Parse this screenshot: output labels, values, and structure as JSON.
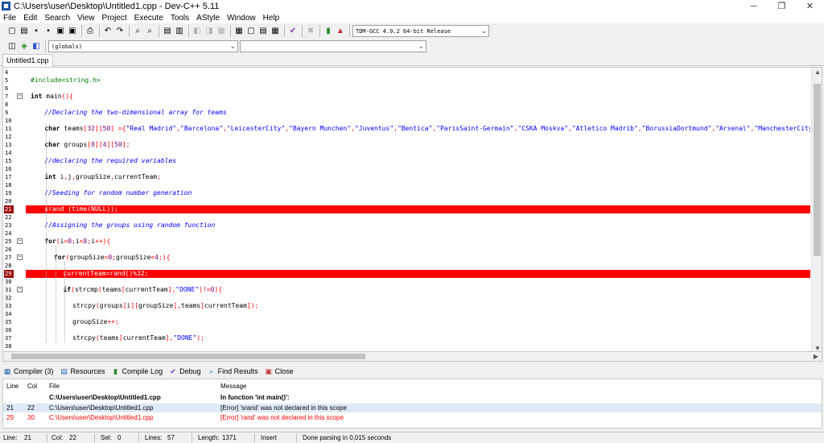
{
  "window": {
    "title": "C:\\Users\\user\\Desktop\\Untitled1.cpp - Dev-C++ 5.11",
    "minimize_glyph": "─",
    "maximize_glyph": "❐",
    "close_glyph": "✕"
  },
  "menu": [
    "File",
    "Edit",
    "Search",
    "View",
    "Project",
    "Execute",
    "Tools",
    "AStyle",
    "Window",
    "Help"
  ],
  "toolbar": {
    "compiler_select": "TDM-GCC 4.9.2 64-bit Release",
    "scope_select": "(globals)",
    "symbol_select": ""
  },
  "file_tab": "Untitled1.cpp",
  "editor": {
    "lines": [
      {
        "n": "4",
        "parts": []
      },
      {
        "n": "5",
        "parts": [
          {
            "t": "#include<string.h>",
            "c": "pre"
          }
        ]
      },
      {
        "n": "6",
        "parts": []
      },
      {
        "n": "7",
        "fold": true,
        "parts": [
          {
            "t": "int",
            "c": "kw"
          },
          {
            "t": " main",
            "c": "id"
          },
          {
            "t": "(){",
            "c": "sym"
          }
        ]
      },
      {
        "n": "8",
        "parts": []
      },
      {
        "n": "9",
        "indent": 3,
        "parts": [
          {
            "t": "//Declaring the two-dimensional array for teams",
            "c": "com"
          }
        ]
      },
      {
        "n": "10",
        "parts": []
      },
      {
        "n": "11",
        "indent": 3,
        "parts": [
          {
            "t": "char",
            "c": "kw"
          },
          {
            "t": " teams",
            "c": "id"
          },
          {
            "t": "[",
            "c": "sym"
          },
          {
            "t": "32",
            "c": "num"
          },
          {
            "t": "][",
            "c": "sym"
          },
          {
            "t": "50",
            "c": "num"
          },
          {
            "t": "] ={",
            "c": "sym"
          },
          {
            "t": "\"Real Madrid\"",
            "c": "str"
          },
          {
            "t": ",",
            "c": "sym"
          },
          {
            "t": "\"Barcelona\"",
            "c": "str"
          },
          {
            "t": ",",
            "c": "sym"
          },
          {
            "t": "\"LeicesterCity\"",
            "c": "str"
          },
          {
            "t": ",",
            "c": "sym"
          },
          {
            "t": "\"Bayern Munchen\"",
            "c": "str"
          },
          {
            "t": ",",
            "c": "sym"
          },
          {
            "t": "\"Juventus\"",
            "c": "str"
          },
          {
            "t": ",",
            "c": "sym"
          },
          {
            "t": "\"Bentica\"",
            "c": "str"
          },
          {
            "t": ",",
            "c": "sym"
          },
          {
            "t": "\"ParisSaint-Germain\"",
            "c": "str"
          },
          {
            "t": ",",
            "c": "sym"
          },
          {
            "t": "\"CSKA Moskva\"",
            "c": "str"
          },
          {
            "t": ",",
            "c": "sym"
          },
          {
            "t": "\"Atletico Madrib\"",
            "c": "str"
          },
          {
            "t": ",",
            "c": "sym"
          },
          {
            "t": "\"BorussiaDortmund\"",
            "c": "str"
          },
          {
            "t": ",",
            "c": "sym"
          },
          {
            "t": "\"Arsenal\"",
            "c": "str"
          },
          {
            "t": ",",
            "c": "sym"
          },
          {
            "t": "\"ManchesterCity\"",
            "c": "str"
          },
          {
            "t": ",",
            "c": "sym"
          },
          {
            "t": "\"Sevi",
            "c": "str"
          }
        ]
      },
      {
        "n": "12",
        "parts": []
      },
      {
        "n": "13",
        "indent": 3,
        "parts": [
          {
            "t": "char",
            "c": "kw"
          },
          {
            "t": " groups",
            "c": "id"
          },
          {
            "t": "[",
            "c": "sym"
          },
          {
            "t": "8",
            "c": "num"
          },
          {
            "t": "][",
            "c": "sym"
          },
          {
            "t": "4",
            "c": "num"
          },
          {
            "t": "][",
            "c": "sym"
          },
          {
            "t": "50",
            "c": "num"
          },
          {
            "t": "];",
            "c": "sym"
          }
        ]
      },
      {
        "n": "14",
        "parts": []
      },
      {
        "n": "15",
        "indent": 3,
        "parts": [
          {
            "t": "//declaring the required variables",
            "c": "com"
          }
        ]
      },
      {
        "n": "16",
        "parts": []
      },
      {
        "n": "17",
        "indent": 3,
        "parts": [
          {
            "t": "int",
            "c": "kw"
          },
          {
            "t": " i",
            "c": "id"
          },
          {
            "t": ",",
            "c": "sym"
          },
          {
            "t": "j",
            "c": "id"
          },
          {
            "t": ",",
            "c": "sym"
          },
          {
            "t": "groupSize",
            "c": "id"
          },
          {
            "t": ",",
            "c": "sym"
          },
          {
            "t": "currentTeam",
            "c": "id"
          },
          {
            "t": ";",
            "c": "sym"
          }
        ]
      },
      {
        "n": "18",
        "parts": []
      },
      {
        "n": "19",
        "indent": 3,
        "parts": [
          {
            "t": "//Seeding for random number generation",
            "c": "com"
          }
        ]
      },
      {
        "n": "20",
        "parts": []
      },
      {
        "n": "21",
        "indent": 3,
        "error": true,
        "parts": [
          {
            "t": "srand (time(NULL));",
            "c": "id"
          }
        ]
      },
      {
        "n": "22",
        "parts": []
      },
      {
        "n": "23",
        "indent": 3,
        "parts": [
          {
            "t": "//Assigning the groups using random function",
            "c": "com"
          }
        ]
      },
      {
        "n": "24",
        "parts": []
      },
      {
        "n": "25",
        "indent": 3,
        "fold": true,
        "parts": [
          {
            "t": "for",
            "c": "kw"
          },
          {
            "t": "(",
            "c": "sym"
          },
          {
            "t": "i",
            "c": "id"
          },
          {
            "t": "=",
            "c": "sym"
          },
          {
            "t": "0",
            "c": "num"
          },
          {
            "t": ";",
            "c": "sym"
          },
          {
            "t": "i",
            "c": "id"
          },
          {
            "t": "<",
            "c": "sym"
          },
          {
            "t": "8",
            "c": "num"
          },
          {
            "t": ";",
            "c": "sym"
          },
          {
            "t": "i",
            "c": "id"
          },
          {
            "t": "++){",
            "c": "sym"
          }
        ]
      },
      {
        "n": "26",
        "parts": []
      },
      {
        "n": "27",
        "indent": 5,
        "fold": true,
        "parts": [
          {
            "t": "for",
            "c": "kw"
          },
          {
            "t": "(",
            "c": "sym"
          },
          {
            "t": "groupSize",
            "c": "id"
          },
          {
            "t": "=",
            "c": "sym"
          },
          {
            "t": "0",
            "c": "num"
          },
          {
            "t": ";",
            "c": "sym"
          },
          {
            "t": "groupSize",
            "c": "id"
          },
          {
            "t": "<",
            "c": "sym"
          },
          {
            "t": "4",
            "c": "num"
          },
          {
            "t": ";){",
            "c": "sym"
          }
        ]
      },
      {
        "n": "28",
        "parts": []
      },
      {
        "n": "29",
        "indent": 7,
        "error": true,
        "parts": [
          {
            "t": "currentTeam=rand()%32;",
            "c": "id"
          }
        ]
      },
      {
        "n": "30",
        "parts": []
      },
      {
        "n": "31",
        "indent": 7,
        "fold": true,
        "parts": [
          {
            "t": "if",
            "c": "kw"
          },
          {
            "t": "(",
            "c": "sym"
          },
          {
            "t": "strcmp",
            "c": "id"
          },
          {
            "t": "(",
            "c": "sym"
          },
          {
            "t": "teams",
            "c": "id"
          },
          {
            "t": "[",
            "c": "sym"
          },
          {
            "t": "currentTeam",
            "c": "id"
          },
          {
            "t": "],",
            "c": "sym"
          },
          {
            "t": "\"DONE\"",
            "c": "str"
          },
          {
            "t": ")!=",
            "c": "sym"
          },
          {
            "t": "0",
            "c": "num"
          },
          {
            "t": "){",
            "c": "sym"
          }
        ]
      },
      {
        "n": "32",
        "parts": []
      },
      {
        "n": "33",
        "indent": 9,
        "parts": [
          {
            "t": "strcpy",
            "c": "id"
          },
          {
            "t": "(",
            "c": "sym"
          },
          {
            "t": "groups",
            "c": "id"
          },
          {
            "t": "[",
            "c": "sym"
          },
          {
            "t": "i",
            "c": "id"
          },
          {
            "t": "][",
            "c": "sym"
          },
          {
            "t": "groupSize",
            "c": "id"
          },
          {
            "t": "],",
            "c": "sym"
          },
          {
            "t": "teams",
            "c": "id"
          },
          {
            "t": "[",
            "c": "sym"
          },
          {
            "t": "currentTeam",
            "c": "id"
          },
          {
            "t": "]);",
            "c": "sym"
          }
        ]
      },
      {
        "n": "34",
        "parts": []
      },
      {
        "n": "35",
        "indent": 9,
        "parts": [
          {
            "t": "groupSize",
            "c": "id"
          },
          {
            "t": "++;",
            "c": "sym"
          }
        ]
      },
      {
        "n": "36",
        "parts": []
      },
      {
        "n": "37",
        "indent": 9,
        "parts": [
          {
            "t": "strcpy",
            "c": "id"
          },
          {
            "t": "(",
            "c": "sym"
          },
          {
            "t": "teams",
            "c": "id"
          },
          {
            "t": "[",
            "c": "sym"
          },
          {
            "t": "currentTeam",
            "c": "id"
          },
          {
            "t": "],",
            "c": "sym"
          },
          {
            "t": "\"DONE\"",
            "c": "str"
          },
          {
            "t": ");",
            "c": "sym"
          }
        ]
      },
      {
        "n": "38",
        "parts": []
      }
    ]
  },
  "bottom_tabs": [
    {
      "label": "Compiler (3)",
      "icon": "compiler-icon",
      "glyph": "▦"
    },
    {
      "label": "Resources",
      "icon": "resources-icon",
      "glyph": "▤"
    },
    {
      "label": "Compile Log",
      "icon": "compile-log-icon",
      "glyph": "▮"
    },
    {
      "label": "Debug",
      "icon": "debug-icon",
      "glyph": "✔"
    },
    {
      "label": "Find Results",
      "icon": "find-results-icon",
      "glyph": "⌕"
    },
    {
      "label": "Close",
      "icon": "close-panel-icon",
      "glyph": "▣"
    }
  ],
  "messages": {
    "headers": {
      "line": "Line",
      "col": "Col",
      "file": "File",
      "message": "Message"
    },
    "rows": [
      {
        "line": "",
        "col": "",
        "file": "C:\\Users\\user\\Desktop\\Untitled1.cpp",
        "message": "In function 'int main()':",
        "style": "bold"
      },
      {
        "line": "21",
        "col": "22",
        "file": "C:\\Users\\user\\Desktop\\Untitled1.cpp",
        "message": "[Error] 'srand' was not declared in this scope",
        "style": "sel"
      },
      {
        "line": "29",
        "col": "30",
        "file": "C:\\Users\\user\\Desktop\\Untitled1.cpp",
        "message": "[Error] 'rand' was not declared in this scope",
        "style": "red"
      }
    ]
  },
  "status": {
    "line": "Line:",
    "line_val": "21",
    "col": "Col:",
    "col_val": "22",
    "sel": "Sel:",
    "sel_val": "0",
    "lines": "Lines:",
    "lines_val": "57",
    "length": "Length:",
    "length_val": "1371",
    "mode": "Insert",
    "message": "Done parsing in 0,015 seconds"
  },
  "colors": {
    "error_highlight": "#ff0000",
    "comment": "#0000ff",
    "string": "#0000ff",
    "preprocessor": "#008000",
    "symbol": "#ff0000",
    "number": "#800080"
  }
}
